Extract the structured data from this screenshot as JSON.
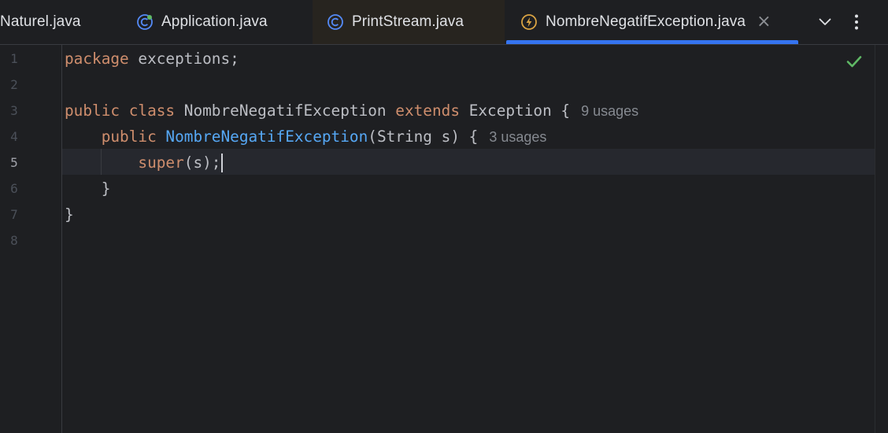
{
  "tabs": [
    {
      "label": "Naturel.java",
      "icon": "class-icon",
      "active": false
    },
    {
      "label": "Application.java",
      "icon": "spring-class-icon",
      "active": false
    },
    {
      "label": "PrintStream.java",
      "icon": "class-icon",
      "active": false
    },
    {
      "label": "NombreNegatifException.java",
      "icon": "exception-class-icon",
      "active": true
    }
  ],
  "tab_tools": {
    "more_tabs": "chevron-down-icon",
    "options": "kebab-menu-icon"
  },
  "editor": {
    "line_numbers": [
      "1",
      "2",
      "3",
      "4",
      "5",
      "6",
      "7",
      "8"
    ],
    "current_line": "5",
    "lines": {
      "l1": {
        "kw": "package",
        "rest": " exceptions;"
      },
      "l3": {
        "kw1": "public",
        "kw2": " class",
        "name": " NombreNegatifException ",
        "kw3": "extends",
        "rest": " Exception {",
        "hint": "9 usages"
      },
      "l4": {
        "kw": "public",
        "fn": " NombreNegatifException",
        "rest": "(String s) {",
        "hint": "3 usages"
      },
      "l5": {
        "kw": "super",
        "rest": "(s);"
      },
      "l6": {
        "rest": "}"
      },
      "l7": {
        "rest": "}"
      }
    },
    "inspection_status": "check-icon"
  },
  "colors": {
    "keyword": "#cf8e6d",
    "function": "#56a8f5",
    "text": "#bcbec4",
    "accent": "#3574f0",
    "ok_green": "#5fb865"
  }
}
